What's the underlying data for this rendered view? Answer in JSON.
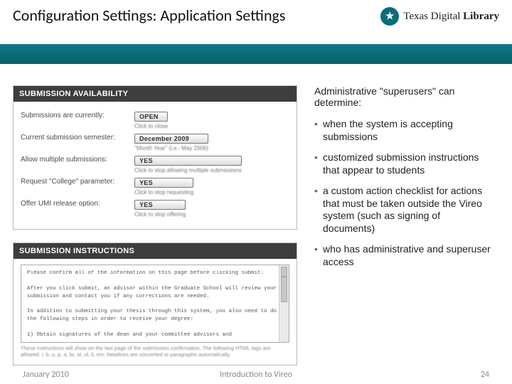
{
  "header": {
    "title": "Configuration Settings: Application Settings",
    "brand_prefix": "Texas Digital ",
    "brand_bold": "Library"
  },
  "panels": {
    "availability": {
      "heading": "SUBMISSION AVAILABILITY",
      "rows": [
        {
          "label": "Submissions are currently:",
          "button": "OPEN",
          "hint": "Click to close"
        },
        {
          "label": "Current submission semester:",
          "button": "December 2009",
          "hint": "\"Month Year\" (i.e.: May 2006)"
        },
        {
          "label": "Allow multiple submissions:",
          "button": "YES",
          "hint": "Click to stop allowing multiple submissions"
        },
        {
          "label": "Request \"College\" parameter:",
          "button": "YES",
          "hint": "Click to stop requesting"
        },
        {
          "label": "Offer UMI release option:",
          "button": "YES",
          "hint": "Click to stop offering"
        }
      ]
    },
    "instructions": {
      "heading": "SUBMISSION INSTRUCTIONS",
      "editor_lines": [
        "Please confirm all of the information on this page before clicking submit.",
        "",
        "After you click submit, an advisor within the Graduate School will review your submission and contact you if any corrections are needed.",
        "",
        "In addition to submitting your thesis through this system, you also need to do the following steps in order to receive your degree:",
        "",
        "1) Obtain signatures of the dean and your committee advisors and"
      ],
      "footnote": "These instructions will show on the last page of the submission confirmation. The following HTML tags are allowed: i, b, u, p, a, br, ol, ul, li, em. Newlines are converted to paragraphs automatically."
    }
  },
  "right": {
    "lead": "Administrative \"superusers\" can determine:",
    "bullets": [
      "when the system is accepting submissions",
      "customized submission instructions that appear to students",
      "a custom action checklist for actions that must be taken outside the Vireo system (such as signing of documents)",
      "who has administrative and superuser access"
    ]
  },
  "footer": {
    "left": "January 2010",
    "center": "Introduction to Vireo",
    "right": "24"
  }
}
